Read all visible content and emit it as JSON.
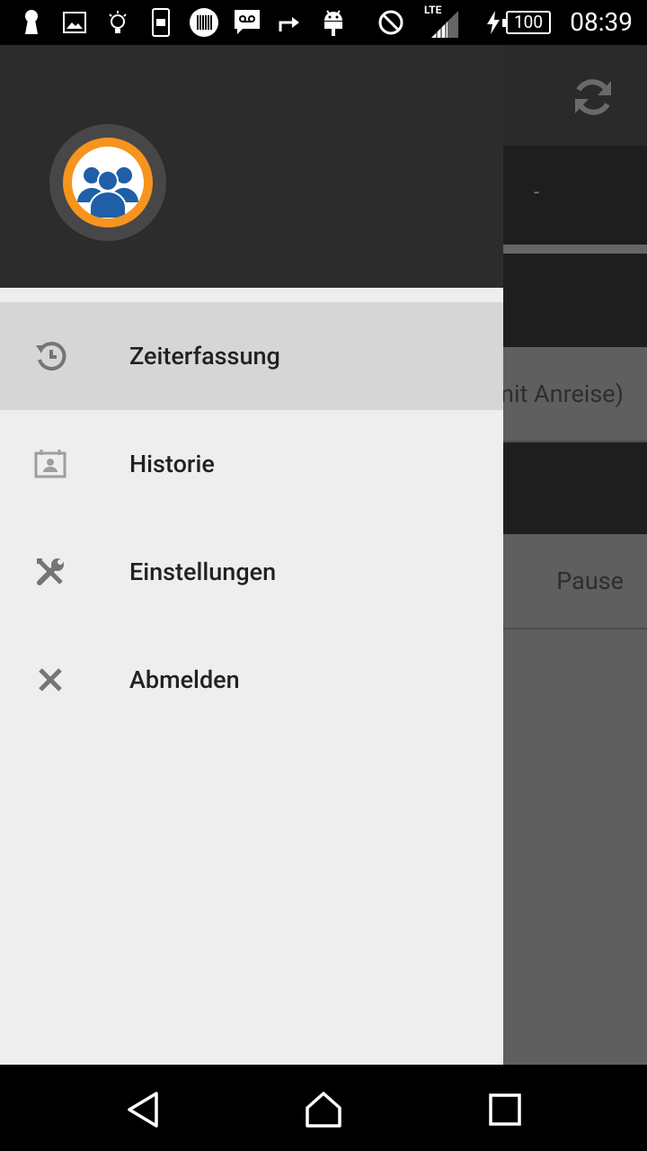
{
  "status_bar": {
    "time": "08:39",
    "battery": "100",
    "network": "LTE",
    "icons": [
      "keyhole-icon",
      "image-icon",
      "bulb-icon",
      "phone-icon",
      "barcode-icon",
      "voicemail-icon",
      "forward-icon",
      "android-icon",
      "blocked-icon",
      "signal-icon",
      "charging-icon",
      "battery-icon"
    ]
  },
  "background_app": {
    "row1_value": "-",
    "row3_text": "mit Anreise)",
    "row5_text": "Pause"
  },
  "drawer": {
    "menu": [
      {
        "label": "Zeiterfassung",
        "icon": "history-icon",
        "active": true
      },
      {
        "label": "Historie",
        "icon": "contact-card-icon",
        "active": false
      },
      {
        "label": "Einstellungen",
        "icon": "tools-icon",
        "active": false
      },
      {
        "label": "Abmelden",
        "icon": "close-icon",
        "active": false
      }
    ]
  },
  "nav_bar": {
    "icons": [
      "back-icon",
      "home-icon",
      "recents-icon"
    ]
  },
  "colors": {
    "drawer_bg": "#eeeeee",
    "header_bg": "#2c2c2c",
    "active_item_bg": "#d6d6d6",
    "avatar_ring": "#f7941d",
    "avatar_people": "#1f5fa8"
  }
}
